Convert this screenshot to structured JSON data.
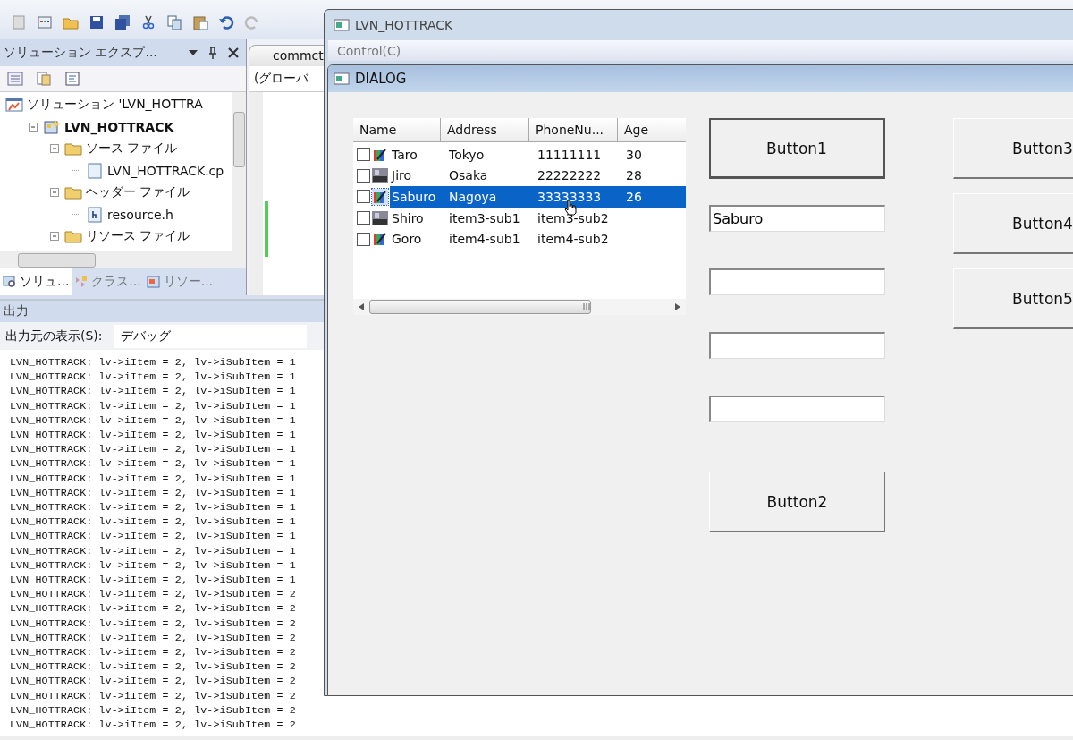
{
  "solution_explorer": {
    "title": "ソリューション エクスプ...",
    "tree": [
      {
        "label": "ソリューション 'LVN_HOTTRA",
        "kind": "solution",
        "children": [
          {
            "label": "LVN_HOTTRACK",
            "kind": "project",
            "expanded": true,
            "children": [
              {
                "label": "ソース ファイル",
                "kind": "folder",
                "expanded": true,
                "children": [
                  {
                    "label": "LVN_HOTTRACK.cp",
                    "kind": "cpp"
                  }
                ]
              },
              {
                "label": "ヘッダー ファイル",
                "kind": "folder",
                "expanded": true,
                "children": [
                  {
                    "label": "resource.h",
                    "kind": "header"
                  }
                ]
              },
              {
                "label": "リソース ファイル",
                "kind": "folder",
                "expanded": true
              }
            ]
          }
        ]
      }
    ],
    "tabs": [
      {
        "label": "ソリュ...",
        "selected": true
      },
      {
        "label": "クラス...",
        "selected": false
      },
      {
        "label": "リソー...",
        "selected": false
      }
    ]
  },
  "editor": {
    "tab": "commct",
    "scope": "(グローバ"
  },
  "output": {
    "title": "出力",
    "source_label": "出力元の表示(S):",
    "source_value": "デバッグ",
    "lines": [
      "LVN_HOTTRACK: lv->iItem = 2, lv->iSubItem = 1",
      "LVN_HOTTRACK: lv->iItem = 2, lv->iSubItem = 1",
      "LVN_HOTTRACK: lv->iItem = 2, lv->iSubItem = 1",
      "LVN_HOTTRACK: lv->iItem = 2, lv->iSubItem = 1",
      "LVN_HOTTRACK: lv->iItem = 2, lv->iSubItem = 1",
      "LVN_HOTTRACK: lv->iItem = 2, lv->iSubItem = 1",
      "LVN_HOTTRACK: lv->iItem = 2, lv->iSubItem = 1",
      "LVN_HOTTRACK: lv->iItem = 2, lv->iSubItem = 1",
      "LVN_HOTTRACK: lv->iItem = 2, lv->iSubItem = 1",
      "LVN_HOTTRACK: lv->iItem = 2, lv->iSubItem = 1",
      "LVN_HOTTRACK: lv->iItem = 2, lv->iSubItem = 1",
      "LVN_HOTTRACK: lv->iItem = 2, lv->iSubItem = 1",
      "LVN_HOTTRACK: lv->iItem = 2, lv->iSubItem = 1",
      "LVN_HOTTRACK: lv->iItem = 2, lv->iSubItem = 1",
      "LVN_HOTTRACK: lv->iItem = 2, lv->iSubItem = 1",
      "LVN_HOTTRACK: lv->iItem = 2, lv->iSubItem = 1",
      "LVN_HOTTRACK: lv->iItem = 2, lv->iSubItem = 2",
      "LVN_HOTTRACK: lv->iItem = 2, lv->iSubItem = 2",
      "LVN_HOTTRACK: lv->iItem = 2, lv->iSubItem = 2",
      "LVN_HOTTRACK: lv->iItem = 2, lv->iSubItem = 2",
      "LVN_HOTTRACK: lv->iItem = 2, lv->iSubItem = 2",
      "LVN_HOTTRACK: lv->iItem = 2, lv->iSubItem = 2",
      "LVN_HOTTRACK: lv->iItem = 2, lv->iSubItem = 2",
      "LVN_HOTTRACK: lv->iItem = 2, lv->iSubItem = 2",
      "LVN_HOTTRACK: lv->iItem = 2, lv->iSubItem = 2",
      "LVN_HOTTRACK: lv->iItem = 2, lv->iSubItem = 2"
    ]
  },
  "app_window": {
    "title": "LVN_HOTTRACK",
    "menu": [
      "Control(C)"
    ]
  },
  "dialog": {
    "title": "DIALOG",
    "list": {
      "columns": [
        "Name",
        "Address",
        "PhoneNu...",
        "Age"
      ],
      "rows": [
        {
          "checked": false,
          "kind": "pencil",
          "selected": false,
          "cells": [
            "Taro",
            "Tokyo",
            "11111111",
            "30"
          ]
        },
        {
          "checked": false,
          "kind": "photo",
          "selected": false,
          "cells": [
            "Jiro",
            "Osaka",
            "22222222",
            "28"
          ]
        },
        {
          "checked": false,
          "kind": "pencil",
          "selected": true,
          "cells": [
            "Saburo",
            "Nagoya",
            "33333333",
            "26"
          ]
        },
        {
          "checked": false,
          "kind": "photo",
          "selected": false,
          "cells": [
            "Shiro",
            "item3-sub1",
            "item3-sub2"
          ]
        },
        {
          "checked": false,
          "kind": "pencil",
          "selected": false,
          "cells": [
            "Goro",
            "item4-sub1",
            "item4-sub2"
          ]
        }
      ]
    },
    "button1": {
      "label": "Button1",
      "default": true
    },
    "fields": [
      {
        "kind": "edit",
        "value": "Saburo"
      },
      {
        "kind": "edit"
      },
      {
        "kind": "edit"
      },
      {
        "kind": "edit"
      }
    ],
    "button2": {
      "label": "Button2",
      "default": false
    },
    "side_buttons": [
      {
        "label": "Button3",
        "default": false
      },
      {
        "label": "Button4",
        "default": false
      },
      {
        "label": "Button5",
        "default": false
      }
    ]
  }
}
